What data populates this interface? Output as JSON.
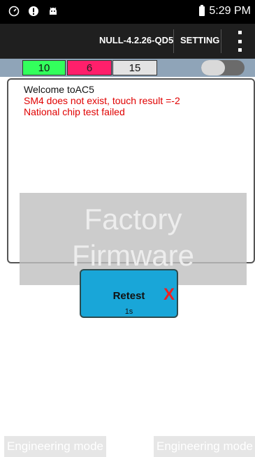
{
  "status_bar": {
    "time": "5:29 PM",
    "icons": [
      "timer-icon",
      "alert-icon",
      "android-icon",
      "battery-icon"
    ]
  },
  "action_bar": {
    "title": "NULL-4.2.26-QD5",
    "setting_label": "SETTING",
    "overflow_icon": "more-vertical-icon"
  },
  "counters": [
    {
      "value": "10",
      "color": "#33ff5c"
    },
    {
      "value": "6",
      "color": "#ff1f6b"
    },
    {
      "value": "15",
      "color": "#e3e3e3"
    }
  ],
  "toggle": {
    "enabled": false
  },
  "log": {
    "lines": [
      {
        "text": "Welcome toAC5",
        "color": "#111111"
      },
      {
        "text": "SM4 does not exist, touch result =-2",
        "color": "#e00000"
      },
      {
        "text": "National chip test failed",
        "color": "#e00000"
      }
    ]
  },
  "watermark": {
    "line1": "Factory",
    "line2": "Firmware"
  },
  "retest": {
    "label": "Retest",
    "status_icon": "x-icon",
    "status_symbol": "X",
    "timer": "1s"
  },
  "footer": {
    "left_button": "Engineering mode",
    "right_button": "Engineering mode"
  }
}
